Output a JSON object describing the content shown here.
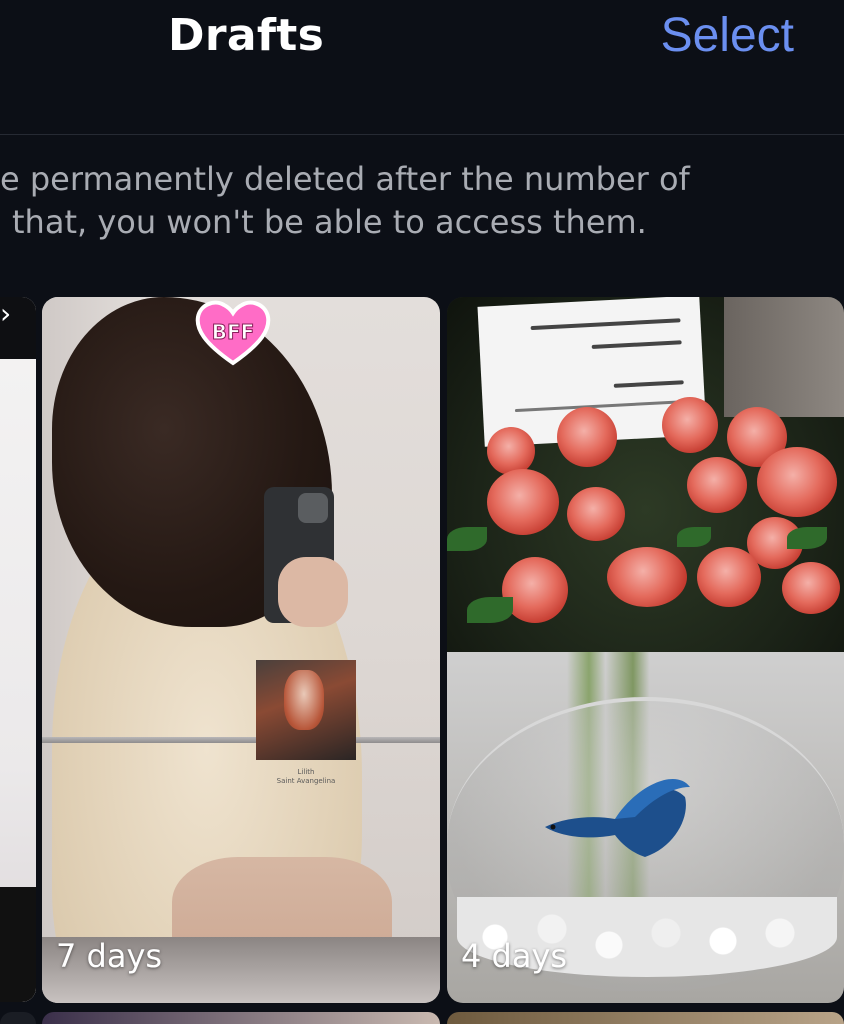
{
  "header": {
    "title": "Drafts",
    "select_label": "Select"
  },
  "info": {
    "line1": "e permanently deleted after the number of",
    "line2": "that, you won't be able to access them."
  },
  "drafts": [
    {
      "days_label": "7 days",
      "sticker": "BFF",
      "music": {
        "title": "Lilith",
        "artist": "Saint Avangelina"
      }
    },
    {
      "days_label": "4 days"
    }
  ],
  "colors": {
    "background": "#0c0f16",
    "accent": "#6b8ff0",
    "info_text": "#a9acb3",
    "sticker_pink": "#ff69c4"
  },
  "icons": {
    "prev_chevron": "chevron-right-icon"
  }
}
